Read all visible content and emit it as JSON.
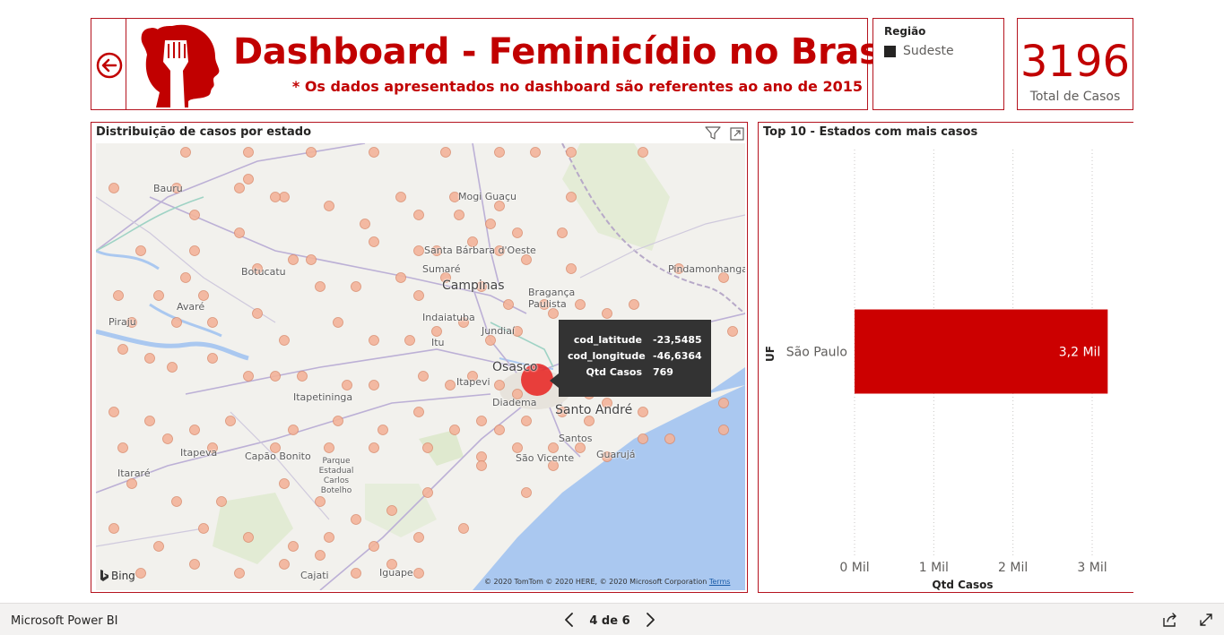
{
  "header": {
    "title": "Dashboard - Feminicídio no Brasil",
    "subtitle": "* Os dados apresentados no dashboard são referentes ao ano de 2015"
  },
  "slicer": {
    "title": "Região",
    "selected": "Sudeste",
    "swatch_color": "#252423"
  },
  "kpi": {
    "value": "3196",
    "label": "Total de Casos"
  },
  "map": {
    "title": "Distribuição de casos por estado",
    "place_labels": {
      "bauru": "Bauru",
      "mogi_guacu": "Mogi Guaçu",
      "santa_barbara": "Santa Bárbara d'Oeste",
      "sumare": "Sumaré",
      "campinas": "Campinas",
      "botucatu": "Botucatu",
      "avare": "Avaré",
      "braganca": "Bragança Paulista",
      "pindamonhangaba": "Pindamonhangaba",
      "piraju": "Piraju",
      "indaiatuba": "Indaiatuba",
      "itu": "Itu",
      "jundiai": "Jundiaí",
      "osasco": "Osasco",
      "itapevi": "Itapevi",
      "itapetininga": "Itapetininga",
      "diadema": "Diadema",
      "santo_andre": "Santo André",
      "itapeva": "Itapeva",
      "capao_bonito": "Capão Bonito",
      "parque": "Parque Estadual Carlos Botelho",
      "santos": "Santos",
      "sao_vicente": "São Vicente",
      "guaruja": "Guarujá",
      "itarare": "Itararé",
      "cajati": "Cajati",
      "iguape": "Iguape"
    },
    "tooltip": {
      "rows": [
        {
          "key": "cod_latitude",
          "value": "-23,5485"
        },
        {
          "key": "cod_longitude",
          "value": "-46,6364"
        },
        {
          "key": "Qtd Casos",
          "value": "769"
        }
      ]
    },
    "bing_label": "Bing",
    "copyright": "© 2020 TomTom © 2020 HERE, © 2020 Microsoft Corporation",
    "terms_label": "Terms",
    "icons": {
      "filter": "filter-icon",
      "focus": "focus-mode-icon"
    },
    "colors": {
      "bubble": "#f4b49a",
      "bubble_highlight": "#e8211e",
      "water": "#aac8f0",
      "land": "#f2f1ed"
    }
  },
  "chart_data": {
    "type": "bar",
    "orientation": "horizontal",
    "title": "Top 10 - Estados com mais casos",
    "categories": [
      "São Paulo"
    ],
    "values": [
      3196
    ],
    "data_labels": [
      "3,2 Mil"
    ],
    "xlabel": "Qtd Casos",
    "ylabel": "UF",
    "xlim": [
      0,
      3000
    ],
    "xticks": [
      0,
      1000,
      2000,
      3000
    ],
    "xtick_labels": [
      "0 Mil",
      "1 Mil",
      "2 Mil",
      "3 Mil"
    ],
    "grid": true,
    "bar_color": "#cc0000"
  },
  "footer": {
    "brand": "Microsoft Power BI",
    "page_indicator": "4 de 6"
  }
}
